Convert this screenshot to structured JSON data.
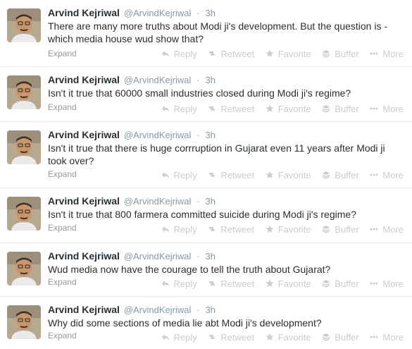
{
  "actions": {
    "reply": "Reply",
    "retweet": "Retweet",
    "favorite": "Favorite",
    "buffer": "Buffer",
    "more": "More",
    "expand": "Expand"
  },
  "tweets": [
    {
      "fullname": "Arvind Kejriwal",
      "username": "@ArvindKejriwal",
      "dot": "·",
      "time": "3h",
      "text": "There are many more truths about Modi ji's development. But the question is - which media house wud show that?"
    },
    {
      "fullname": "Arvind Kejriwal",
      "username": "@ArvindKejriwal",
      "dot": "·",
      "time": "3h",
      "text": "Isn't it true that 60000 small industries closed during Modi ji's regime?"
    },
    {
      "fullname": "Arvind Kejriwal",
      "username": "@ArvindKejriwal",
      "dot": "·",
      "time": "3h",
      "text": "Isn't it true that there is huge corrruption in Gujarat even 11 years after Modi ji took over?"
    },
    {
      "fullname": "Arvind Kejriwal",
      "username": "@ArvindKejriwal",
      "dot": "·",
      "time": "3h",
      "text": "Isn't it true that 800 farmera committed suicide during Modi ji's regime?"
    },
    {
      "fullname": "Arvind Kejriwal",
      "username": "@ArvindKejriwal",
      "dot": "·",
      "time": "3h",
      "text": "Wud media now have the courage to tell the truth about Gujarat?"
    },
    {
      "fullname": "Arvind Kejriwal",
      "username": "@ArvindKejriwal",
      "dot": "·",
      "time": "3h",
      "text": "Why did some sections of media lie abt Modi ji's development?"
    }
  ]
}
